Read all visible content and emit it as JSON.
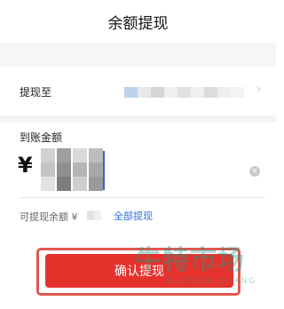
{
  "header": {
    "title": "余额提现"
  },
  "withdraw_to": {
    "label": "提现至",
    "chevron": "chevron-right-icon"
  },
  "amount": {
    "title": "到账金额",
    "currency": "¥",
    "clear_icon": "×"
  },
  "available": {
    "label": "可提现余额 ¥",
    "withdraw_all": "全部提现"
  },
  "confirm": {
    "label": "确认提现"
  },
  "watermark": {
    "cn": "牛特市场",
    "en": "NIUTESHICHANG"
  },
  "colors": {
    "accent_red": "#e6322d",
    "link_blue": "#2f6de0",
    "caret_blue": "#2b66d9",
    "highlight_red": "#e2574f",
    "watermark_green": "#16a085"
  }
}
